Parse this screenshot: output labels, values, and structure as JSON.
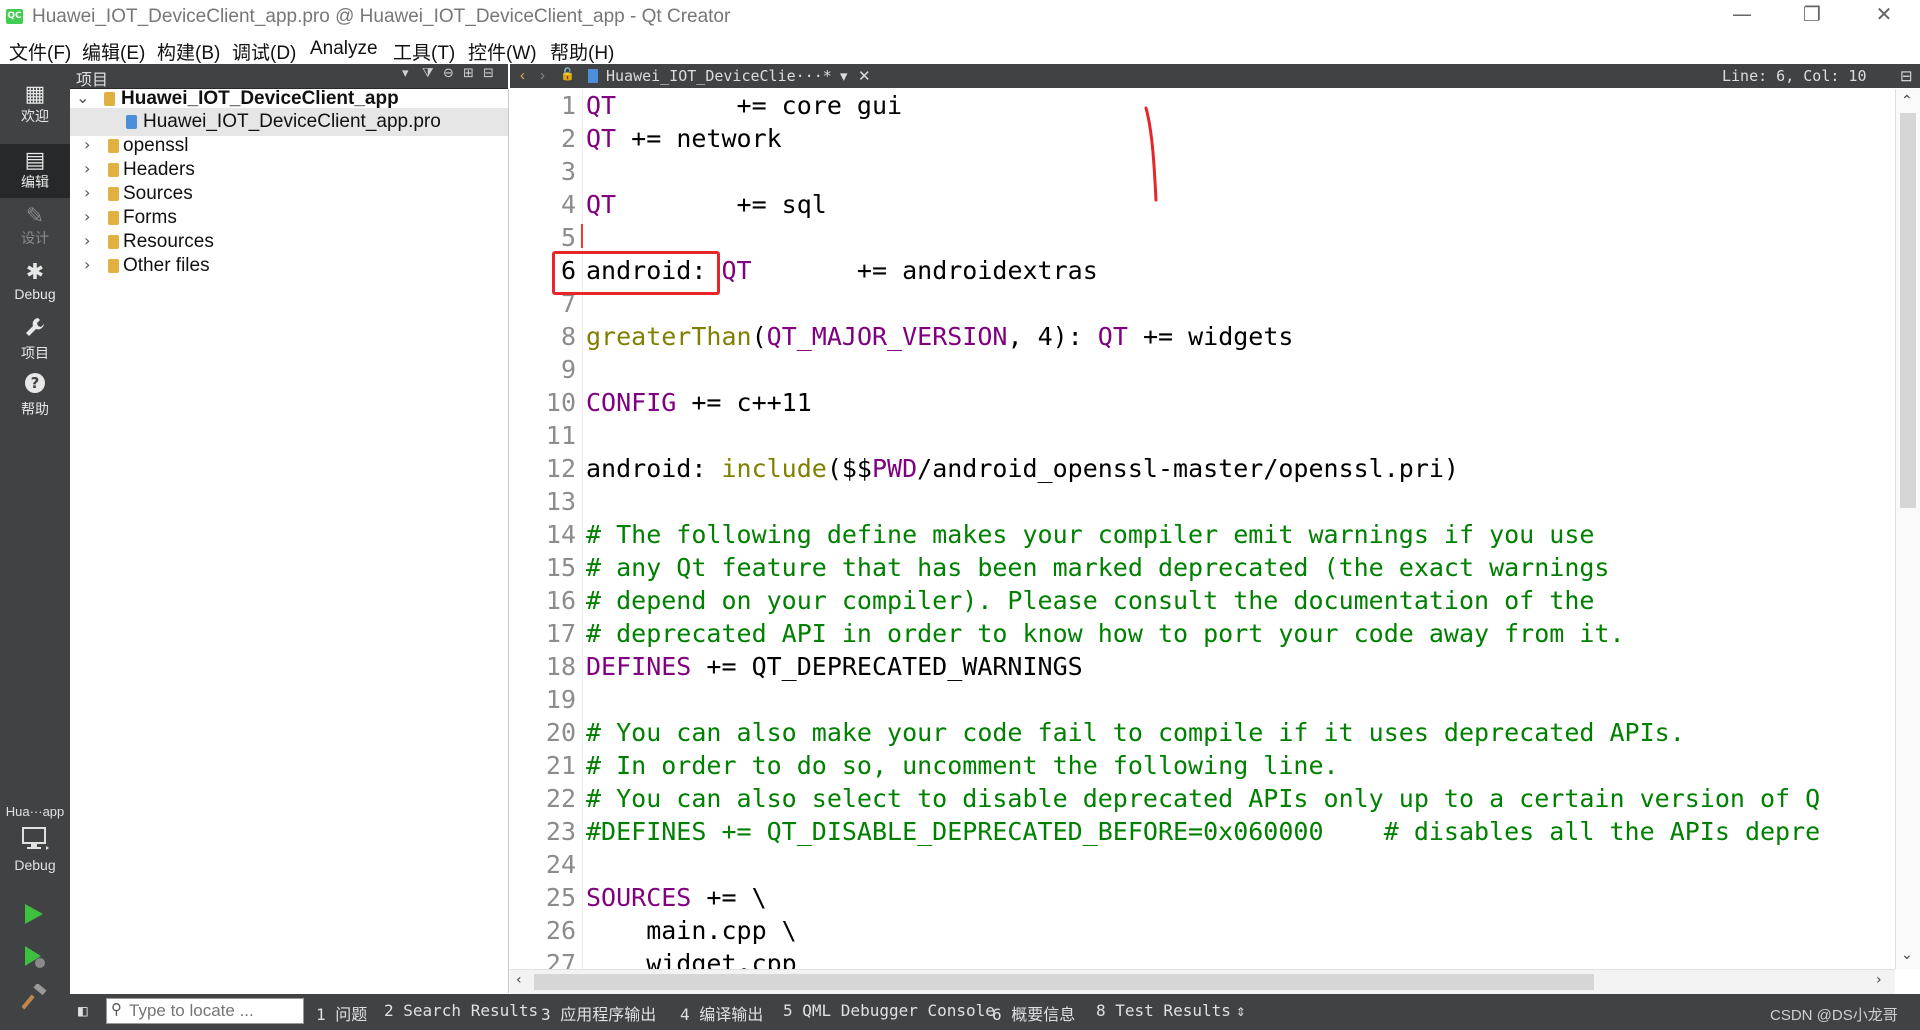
{
  "window": {
    "title": "Huawei_IOT_DeviceClient_app.pro @ Huawei_IOT_DeviceClient_app - Qt Creator",
    "app_badge": "QC",
    "controls": {
      "minimize": "—",
      "maximize": "❐",
      "close": "✕"
    }
  },
  "menu": [
    "文件(F)",
    "编辑(E)",
    "构建(B)",
    "调试(D)",
    "Analyze",
    "工具(T)",
    "控件(W)",
    "帮助(H)"
  ],
  "modes": [
    {
      "icon": "grid-icon",
      "glyph": "▦",
      "label": "欢迎",
      "state": "normal"
    },
    {
      "icon": "edit-icon",
      "glyph": "▤",
      "label": "编辑",
      "state": "active"
    },
    {
      "icon": "pencil-icon",
      "glyph": "✎",
      "label": "设计",
      "state": "disabled"
    },
    {
      "icon": "bug-icon",
      "glyph": "✱",
      "label": "Debug",
      "state": "normal"
    },
    {
      "icon": "wrench-icon",
      "glyph": "🔧",
      "label": "项目",
      "state": "normal"
    },
    {
      "icon": "help-icon",
      "glyph": "?",
      "label": "帮助",
      "state": "normal"
    }
  ],
  "kit": {
    "project_short": "Hua···app",
    "build_mode": "Debug"
  },
  "project_pane": {
    "title": "项目",
    "root": "Huawei_IOT_DeviceClient_app",
    "items": [
      {
        "label": "Huawei_IOT_DeviceClient_app.pro",
        "selected": true,
        "expandable": false,
        "icon_color": "#4a8fd8"
      },
      {
        "label": "openssl",
        "selected": false,
        "expandable": true,
        "icon_color": "#e0b040"
      },
      {
        "label": "Headers",
        "selected": false,
        "expandable": true,
        "icon_color": "#e0b040"
      },
      {
        "label": "Sources",
        "selected": false,
        "expandable": true,
        "icon_color": "#e0b040"
      },
      {
        "label": "Forms",
        "selected": false,
        "expandable": true,
        "icon_color": "#e0b040"
      },
      {
        "label": "Resources",
        "selected": false,
        "expandable": true,
        "icon_color": "#e0b040"
      },
      {
        "label": "Other files",
        "selected": false,
        "expandable": true,
        "icon_color": "#e0b040"
      }
    ]
  },
  "editor_toolbar": {
    "file_tab": "Huawei_IOT_DeviceClie···*",
    "position": "Line: 6, Col: 10"
  },
  "code_lines": [
    {
      "n": "1",
      "tokens": [
        {
          "t": "QT",
          "c": "k"
        },
        {
          "t": "        += core gui",
          "c": ""
        }
      ]
    },
    {
      "n": "2",
      "tokens": [
        {
          "t": "QT",
          "c": "k"
        },
        {
          "t": " += network",
          "c": ""
        }
      ]
    },
    {
      "n": "3",
      "tokens": []
    },
    {
      "n": "4",
      "tokens": [
        {
          "t": "QT",
          "c": "k"
        },
        {
          "t": "        += sql",
          "c": ""
        }
      ]
    },
    {
      "n": "5",
      "tokens": []
    },
    {
      "n": "6",
      "tokens": [
        {
          "t": "android: ",
          "c": ""
        },
        {
          "t": "QT",
          "c": "k"
        },
        {
          "t": "       += androidextras",
          "c": ""
        }
      ]
    },
    {
      "n": "7",
      "tokens": []
    },
    {
      "n": "8",
      "tokens": [
        {
          "t": "greaterThan",
          "c": "f"
        },
        {
          "t": "(",
          "c": ""
        },
        {
          "t": "QT_MAJOR_VERSION",
          "c": "k"
        },
        {
          "t": ", 4): ",
          "c": ""
        },
        {
          "t": "QT",
          "c": "k"
        },
        {
          "t": " += widgets",
          "c": ""
        }
      ]
    },
    {
      "n": "9",
      "tokens": []
    },
    {
      "n": "10",
      "tokens": [
        {
          "t": "CONFIG",
          "c": "k"
        },
        {
          "t": " += c++11",
          "c": ""
        }
      ]
    },
    {
      "n": "11",
      "tokens": []
    },
    {
      "n": "12",
      "tokens": [
        {
          "t": "android: ",
          "c": ""
        },
        {
          "t": "include",
          "c": "f"
        },
        {
          "t": "($$",
          "c": ""
        },
        {
          "t": "PWD",
          "c": "v"
        },
        {
          "t": "/android_openssl-master/openssl.pri)",
          "c": ""
        }
      ]
    },
    {
      "n": "13",
      "tokens": []
    },
    {
      "n": "14",
      "tokens": [
        {
          "t": "# The following define makes your compiler emit warnings if you use",
          "c": "cm"
        }
      ]
    },
    {
      "n": "15",
      "tokens": [
        {
          "t": "# any Qt feature that has been marked deprecated (the exact warnings",
          "c": "cm"
        }
      ]
    },
    {
      "n": "16",
      "tokens": [
        {
          "t": "# depend on your compiler). Please consult the documentation of the",
          "c": "cm"
        }
      ]
    },
    {
      "n": "17",
      "tokens": [
        {
          "t": "# deprecated API in order to know how to port your code away from it.",
          "c": "cm"
        }
      ]
    },
    {
      "n": "18",
      "tokens": [
        {
          "t": "DEFINES",
          "c": "k"
        },
        {
          "t": " += QT_DEPRECATED_WARNINGS",
          "c": ""
        }
      ]
    },
    {
      "n": "19",
      "tokens": []
    },
    {
      "n": "20",
      "tokens": [
        {
          "t": "# You can also make your code fail to compile if it uses deprecated APIs.",
          "c": "cm"
        }
      ]
    },
    {
      "n": "21",
      "tokens": [
        {
          "t": "# In order to do so, uncomment the following line.",
          "c": "cm"
        }
      ]
    },
    {
      "n": "22",
      "tokens": [
        {
          "t": "# You can also select to disable deprecated APIs only up to a certain version of Q",
          "c": "cm"
        }
      ]
    },
    {
      "n": "23",
      "tokens": [
        {
          "t": "#DEFINES += QT_DISABLE_DEPRECATED_BEFORE=0x060000    # disables all the APIs depre",
          "c": "cm"
        }
      ]
    },
    {
      "n": "24",
      "tokens": []
    },
    {
      "n": "25",
      "tokens": [
        {
          "t": "SOURCES",
          "c": "k"
        },
        {
          "t": " += \\",
          "c": ""
        }
      ]
    },
    {
      "n": "26",
      "tokens": [
        {
          "t": "    main.cpp \\",
          "c": ""
        }
      ]
    },
    {
      "n": "27",
      "tokens": [
        {
          "t": "    widget.cpp",
          "c": ""
        }
      ]
    }
  ],
  "status_bar": {
    "locate_placeholder": "Type to locate ...",
    "panes": [
      "1 问题",
      "2 Search Results",
      "3 应用程序输出",
      "4 编译输出",
      "5 QML Debugger Console",
      "6 概要信息",
      "8 Test Results"
    ],
    "watermark": "CSDN @DS小龙哥"
  }
}
